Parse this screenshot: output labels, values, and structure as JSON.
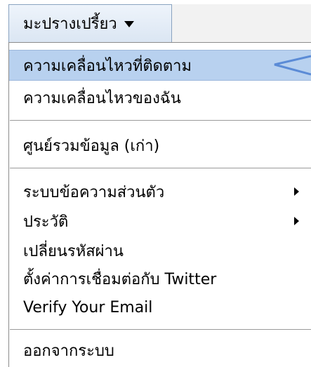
{
  "header": {
    "menu_label": "มะปรางเปรี้ยว"
  },
  "menu": {
    "items": [
      {
        "label": "ความเคลื่อนไหวที่ติดตาม",
        "highlighted": true,
        "submenu": false
      },
      {
        "label": "ความเคลื่อนไหวของฉัน",
        "highlighted": false,
        "submenu": false
      },
      {
        "label": "ศูนย์รวมข้อมูล (เก่า)",
        "highlighted": false,
        "submenu": false
      },
      {
        "label": "ระบบข้อความส่วนตัว",
        "highlighted": false,
        "submenu": true
      },
      {
        "label": "ประวัติ",
        "highlighted": false,
        "submenu": true
      },
      {
        "label": "เปลี่ยนรหัสผ่าน",
        "highlighted": false,
        "submenu": false
      },
      {
        "label": "ตั้งค่าการเชื่อมต่อกับ Twitter",
        "highlighted": false,
        "submenu": false
      },
      {
        "label": "Verify Your Email",
        "highlighted": false,
        "submenu": false
      },
      {
        "label": "ออกจากระบบ",
        "highlighted": false,
        "submenu": false
      }
    ]
  },
  "colors": {
    "highlight": "#b8d1ef",
    "pointer": "#5b8bd6"
  }
}
